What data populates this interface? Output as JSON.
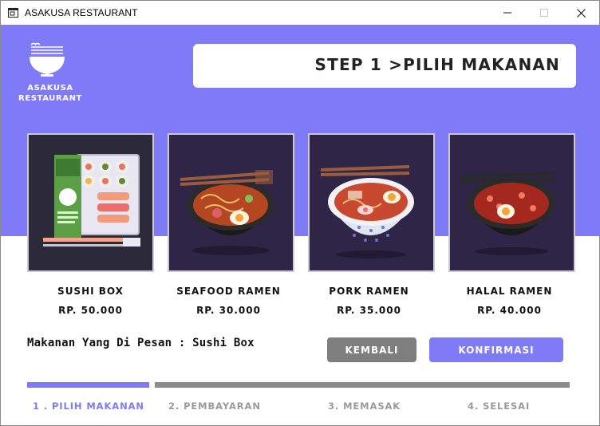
{
  "window": {
    "title": "ASAKUSA RESTAURANT",
    "controls": {
      "minimize": "minimize-icon",
      "maximize": "maximize-icon",
      "close": "close-icon"
    }
  },
  "brand": {
    "icon": "ramen-bowl-icon",
    "name_line1": "ASAKUSA",
    "name_line2": "RESTAURANT"
  },
  "header": {
    "step_title": "STEP 1 >PILIH MAKANAN"
  },
  "menu": [
    {
      "name": "SUSHI BOX",
      "price": "RP. 50.000",
      "image": "sushi-box-image"
    },
    {
      "name": "SEAFOOD RAMEN",
      "price": "RP. 30.000",
      "image": "seafood-ramen-image"
    },
    {
      "name": "PORK RAMEN",
      "price": "RP. 35.000",
      "image": "pork-ramen-image"
    },
    {
      "name": "HALAL RAMEN",
      "price": "RP. 40.000",
      "image": "halal-ramen-image"
    }
  ],
  "order": {
    "label": "Makanan Yang Di Pesan : ",
    "value": "Sushi Box"
  },
  "buttons": {
    "back": "KEMBALI",
    "confirm": "KONFIRMASI"
  },
  "progress": {
    "current_step": 1,
    "steps": [
      "1 . PILIH MAKANAN",
      "2. PEMBAYARAN",
      "3. MEMASAK",
      "4. SELESAI"
    ]
  },
  "colors": {
    "accent": "#7f7af7",
    "button_gray": "#7e7e7e",
    "card_background": "#2d2440",
    "inactive_step": "#9a9a9a"
  }
}
